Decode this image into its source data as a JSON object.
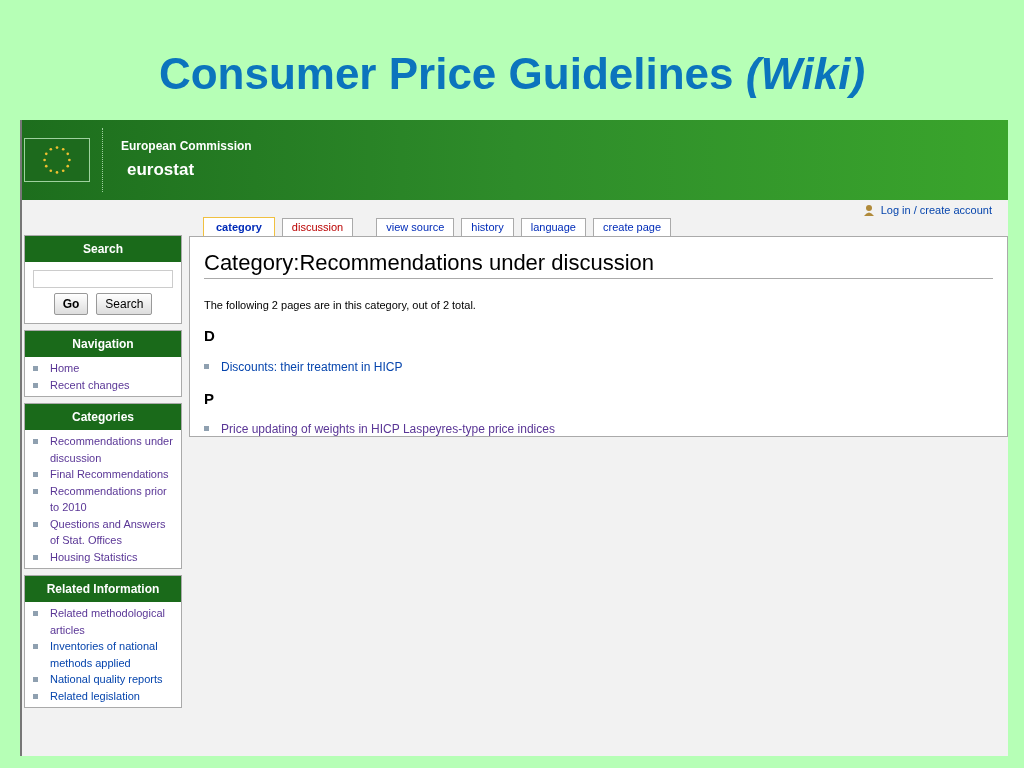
{
  "slide_title": "Consumer Price Guidelines *(Wiki)*",
  "header": {
    "organization": "European Commission",
    "logo_text": "eurostat"
  },
  "personal": {
    "login": "Log in / create account"
  },
  "tabs": [
    {
      "label": "category",
      "selected": true,
      "missing": false
    },
    {
      "label": "discussion",
      "selected": false,
      "missing": true
    },
    {
      "label": "view source",
      "selected": false,
      "missing": false
    },
    {
      "label": "history",
      "selected": false,
      "missing": false
    },
    {
      "label": "language",
      "selected": false,
      "missing": false
    },
    {
      "label": "create page",
      "selected": false,
      "missing": false
    }
  ],
  "search": {
    "title": "Search",
    "buttons": [
      "Go",
      "Search"
    ]
  },
  "sidebar": [
    {
      "title": "Navigation",
      "items": [
        {
          "label": "Home",
          "visited": true
        },
        {
          "label": "Recent changes",
          "visited": true
        }
      ]
    },
    {
      "title": "Categories",
      "items": [
        {
          "label": "Recommendations under discussion",
          "visited": true
        },
        {
          "label": "Final Recommendations",
          "visited": true
        },
        {
          "label": "Recommendations prior to 2010",
          "visited": true
        },
        {
          "label": "Questions and Answers of Stat. Offices",
          "visited": true
        },
        {
          "label": "Housing Statistics",
          "visited": true
        }
      ]
    },
    {
      "title": "Related Information",
      "items": [
        {
          "label": "Related methodological articles",
          "visited": true
        },
        {
          "label": "Inventories of national methods applied",
          "visited": false
        },
        {
          "label": "National quality reports",
          "visited": false
        },
        {
          "label": "Related legislation",
          "visited": false
        }
      ]
    }
  ],
  "content": {
    "heading": "Category:Recommendations under discussion",
    "intro": "The following 2 pages are in this category, out of 2 total.",
    "groups": [
      {
        "letter": "D",
        "pages": [
          {
            "label": "Discounts: their treatment in HICP",
            "visited": false
          }
        ]
      },
      {
        "letter": "P",
        "pages": [
          {
            "label": "Price updating of weights in HICP Laspeyres-type price indices",
            "visited": true
          }
        ]
      }
    ]
  }
}
